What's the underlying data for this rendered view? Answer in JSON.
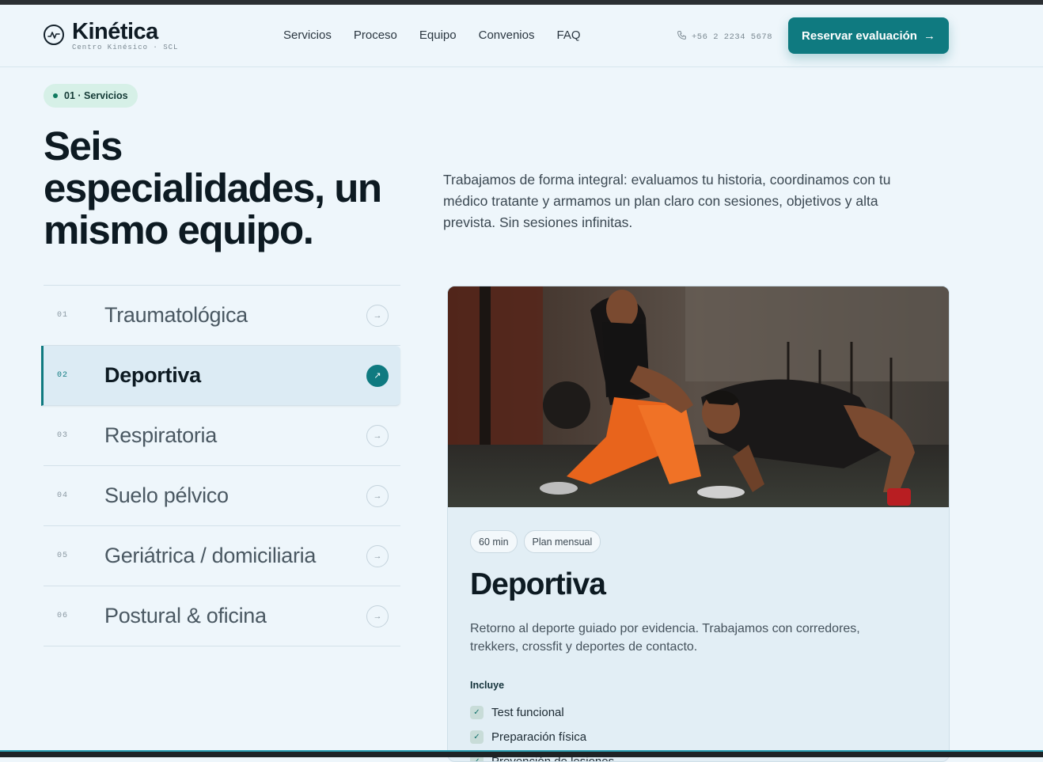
{
  "brand": {
    "name": "Kinética",
    "tagline": "Centro Kinésico · SCL"
  },
  "nav": [
    "Servicios",
    "Proceso",
    "Equipo",
    "Convenios",
    "FAQ"
  ],
  "phone": "+56 2 2234 5678",
  "cta": {
    "label": "Reservar evaluación",
    "icon": "arrow-right-icon"
  },
  "section": {
    "eyebrow": "01 · Servicios",
    "title": "Seis especialidades, un mismo equipo.",
    "description": "Trabajamos de forma integral: evaluamos tu historia, coordinamos con tu médico tratante y armamos un plan claro con sesiones, objetivos y alta prevista. Sin sesiones infinitas."
  },
  "services": [
    {
      "num": "01",
      "name": "Traumatológica",
      "active": false
    },
    {
      "num": "02",
      "name": "Deportiva",
      "active": true
    },
    {
      "num": "03",
      "name": "Respiratoria",
      "active": false
    },
    {
      "num": "04",
      "name": "Suelo pélvico",
      "active": false
    },
    {
      "num": "05",
      "name": "Geriátrica / domiciliaria",
      "active": false
    },
    {
      "num": "06",
      "name": "Postural & oficina",
      "active": false
    }
  ],
  "detail": {
    "chips": [
      "60 min",
      "Plan mensual"
    ],
    "title": "Deportiva",
    "description": "Retorno al deporte guiado por evidencia. Trabajamos con corredores, trekkers, crossfit y deportes de contacto.",
    "includes_label": "Incluye",
    "includes": [
      "Test funcional",
      "Preparación física",
      "Prevención de lesiones"
    ]
  },
  "colors": {
    "accent": "#0f7a80",
    "background": "#eef6fb"
  }
}
